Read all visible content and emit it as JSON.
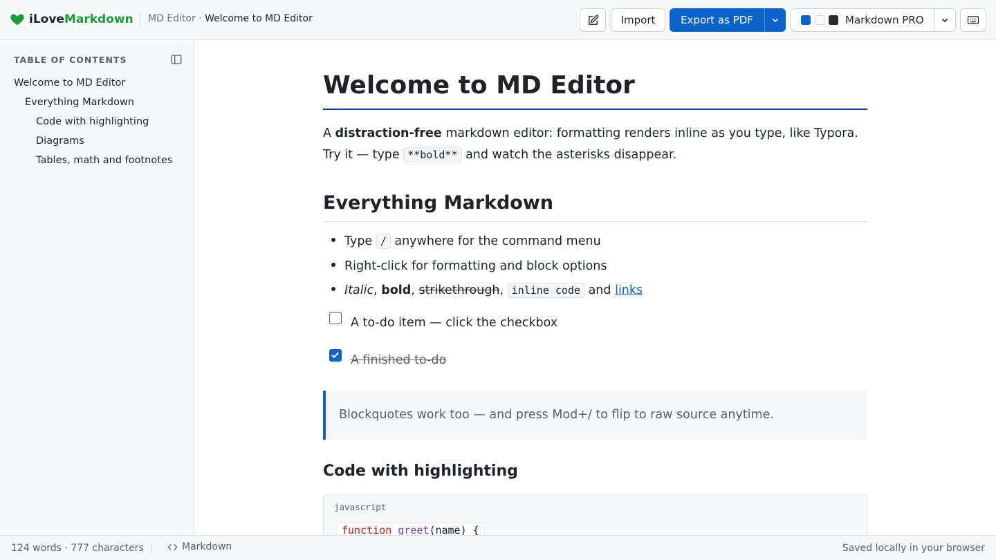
{
  "app": {
    "logo_part1": "iLove",
    "logo_part2": "Markdown",
    "breadcrumb_parent": "MD Editor",
    "breadcrumb_sep": " · ",
    "breadcrumb_current": "Welcome to MD Editor"
  },
  "toolbar": {
    "edit_icon": "pencil-square-icon",
    "import_label": "Import",
    "export_label": "Export as PDF",
    "theme_label": "Markdown PRO",
    "keyboard_icon": "keyboard-icon",
    "accent_color": "#0b63c9",
    "brand_color": "#1a9c3a"
  },
  "sidebar": {
    "title": "TABLE OF CONTENTS",
    "items": [
      {
        "label": "Welcome to MD Editor",
        "level": 1
      },
      {
        "label": "Everything Markdown",
        "level": 2
      },
      {
        "label": "Code with highlighting",
        "level": 3
      },
      {
        "label": "Diagrams",
        "level": 3
      },
      {
        "label": "Tables, math and footnotes",
        "level": 3
      }
    ]
  },
  "doc": {
    "h1": "Welcome to MD Editor",
    "intro": {
      "a": "A ",
      "bold": "distraction-free",
      "b": " markdown editor: formatting renders inline as you type, like Typora. Try it — type ",
      "code": "**bold**",
      "c": " and watch the asterisks disappear."
    },
    "h2": "Everything Markdown",
    "list": {
      "item1_pre": "Type ",
      "item1_code": "/",
      "item1_post": " anywhere for the command menu",
      "item2": "Right-click for formatting and block options",
      "item3_italic": "Italic",
      "item3_comma1": ", ",
      "item3_bold": "bold",
      "item3_comma2": ", ",
      "item3_strike": "strikethrough",
      "item3_comma3": ", ",
      "item3_code": "inline code",
      "item3_and": " and ",
      "item3_link": "links"
    },
    "tasks": [
      {
        "label": "A to-do item — click the checkbox",
        "checked": false
      },
      {
        "label": "A finished to-do",
        "checked": true
      }
    ],
    "quote": "Blockquotes work too — and press Mod+/ to flip to raw source anytime.",
    "h3": "Code with highlighting",
    "code_lang": "javascript",
    "code_kw": "function",
    "code_fn": "greet",
    "code_rest": "(name) {"
  },
  "status": {
    "counts": "124 words · 777 characters",
    "mode": "Markdown",
    "saved": "Saved locally in your browser"
  }
}
